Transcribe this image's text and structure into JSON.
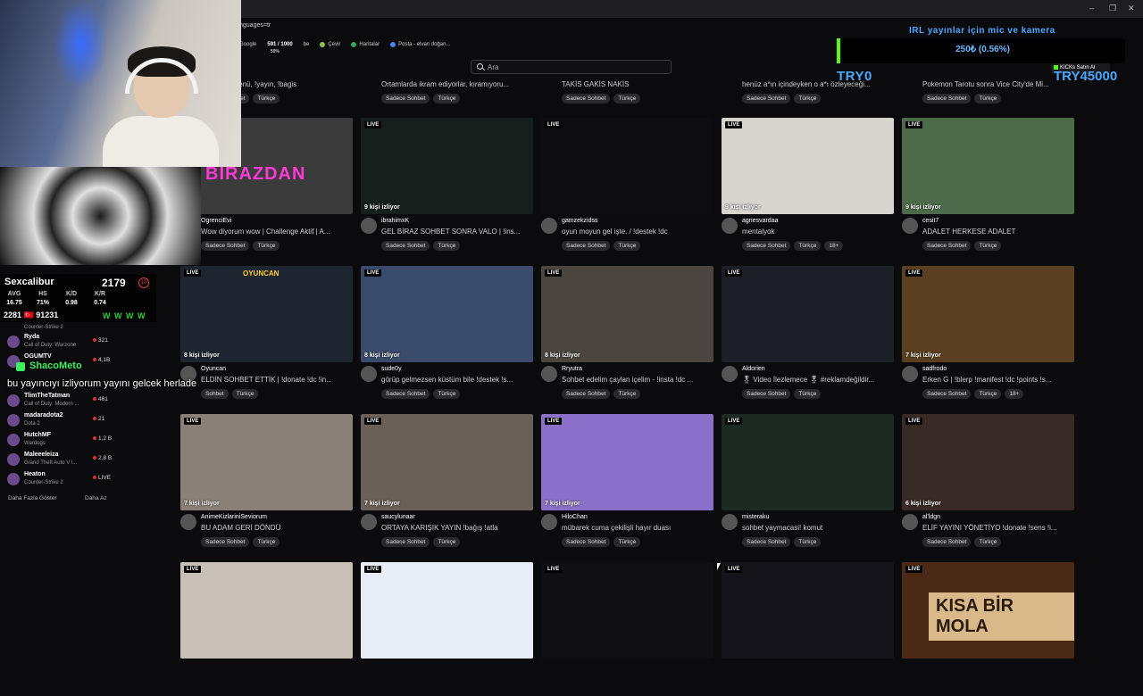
{
  "browser": {
    "url_fragment": "nguages=tr",
    "bookmarks": [
      "Google",
      "591 / 1000",
      "be",
      "Çevir",
      "Haritalar",
      "Posta - elvan doğan..."
    ],
    "bookmark_sub": "59%",
    "window_controls": [
      "–",
      "❐",
      "✕"
    ]
  },
  "search": {
    "placeholder": "Ara"
  },
  "kick_button": {
    "label": "KICKs Satın Al"
  },
  "top_row": [
    {
      "title": "umalaaer menü, !yayın, !bagis",
      "tags": [
        "Sadece Sohbet",
        "Türkçe"
      ]
    },
    {
      "title": "Ortamlarda ikram ediyorlar, kıramıyoru...",
      "tags": [
        "Sadece Sohbet",
        "Türkçe"
      ]
    },
    {
      "title": "TAKİS GAKİS NAKİS",
      "tags": [
        "Sadece Sohbet",
        "Türkçe"
      ]
    },
    {
      "title": "henüz a*ın içindeyken o a*ı özleyeceği...",
      "tags": [
        "Sadece Sohbet",
        "Türkçe"
      ]
    },
    {
      "title": "Pokemon Tarotu sonra Vice City'de Mi...",
      "tags": [
        "Sadece Sohbet",
        "Türkçe"
      ]
    }
  ],
  "streams": [
    {
      "name": "OgrenciEvi",
      "title": "Wow diyorum wow | Challenge Aktif | A...",
      "viewers": "",
      "tags": [
        "Sadece Sohbet",
        "Türkçe"
      ],
      "overlay": "BİRAZDAN",
      "bg": "#3b3b3b"
    },
    {
      "name": "ibrahimxK",
      "title": "GEL BİRAZ SOHBET SONRA VALO | !ins...",
      "viewers": "9 kişi izliyor",
      "tags": [
        "Sadece Sohbet",
        "Türkçe"
      ],
      "overlay": "",
      "bg": "#15201d"
    },
    {
      "name": "gamzekzidss",
      "title": "oyun moyun gel işte. / !destek !dc",
      "viewers": "",
      "tags": [
        "Sadece Sohbet",
        "Türkçe"
      ],
      "overlay": "",
      "bg": "#0d0d10"
    },
    {
      "name": "agnesvardaa",
      "title": "mentalyok",
      "viewers": "9 kişi izliyor",
      "tags": [
        "Sadece Sohbet",
        "Türkçe",
        "18+"
      ],
      "overlay": "",
      "bg": "#d8d4cf"
    },
    {
      "name": "cesit7",
      "title": "ADALET HERKESE ADALET",
      "viewers": "9 kişi izliyor",
      "tags": [
        "Sadece Sohbet",
        "Türkçe"
      ],
      "overlay": "",
      "bg": "#4d6a4a"
    },
    {
      "name": "Oyuncan",
      "title": "ELDİN SOHBET ETTİK | !donate !dc !in...",
      "viewers": "8 kişi izliyor",
      "tags": [
        "Sohbet",
        "Türkçe"
      ],
      "overlay": "OYUNCAN",
      "bg": "#1d2530"
    },
    {
      "name": "sude0y",
      "title": "görüp gelmezsen küstüm bile !destek !s...",
      "viewers": "8 kişi izliyor",
      "tags": [
        "Sadece Sohbet",
        "Türkçe"
      ],
      "overlay": "",
      "bg": "#3a4a6a"
    },
    {
      "name": "Rryutra",
      "title": "Sohbet edelim çaylan içelim - !insta !dc ...",
      "viewers": "8 kişi izliyor",
      "tags": [
        "Sadece Sohbet",
        "Türkçe"
      ],
      "overlay": "",
      "bg": "#4a463f"
    },
    {
      "name": "Aldorien",
      "title": "🎖 Video İlezlemece 🎖 #reklamdeğildir...",
      "viewers": "",
      "tags": [
        "Sadece Sohbet",
        "Türkçe"
      ],
      "overlay": "",
      "bg": "#1c1f26"
    },
    {
      "name": "sadfrodo",
      "title": "Erken G | !blerp !manifest !dc !points !s...",
      "viewers": "7 kişi izliyor",
      "tags": [
        "Sadece Sohbet",
        "Türkçe",
        "18+"
      ],
      "overlay": "",
      "bg": "#5a4020"
    },
    {
      "name": "AnimeKizlariniSeviorum",
      "title": "BU ADAM GERİ DÖNDÜ",
      "viewers": "7 kişi izliyor",
      "tags": [
        "Sadece Sohbet",
        "Türkçe"
      ],
      "overlay": "",
      "bg": "#8a8078"
    },
    {
      "name": "saucylunaar",
      "title": "ORTAYA KARIŞIK YAYIN !bağış !atla",
      "viewers": "7 kişi izliyor",
      "tags": [
        "Sadece Sohbet",
        "Türkçe"
      ],
      "overlay": "",
      "bg": "#6a6058"
    },
    {
      "name": "HiloChan",
      "title": "mübarek cuma çekilişli hayır duası",
      "viewers": "7 kişi izliyor",
      "tags": [
        "Sadece Sohbet",
        "Türkçe"
      ],
      "overlay": "",
      "bg": "#8a70c8"
    },
    {
      "name": "misteraku",
      "title": "sohbet yaymacasi! komut",
      "viewers": "",
      "tags": [
        "Sadece Sohbet",
        "Türkçe"
      ],
      "overlay": "",
      "bg": "#1d2a24"
    },
    {
      "name": "al'ldgn",
      "title": "ELİF YAYINI YÖNETİYO !donate !sens !i...",
      "viewers": "6 kişi izliyor",
      "tags": [
        "Sadece Sohbet",
        "Türkçe"
      ],
      "overlay": "",
      "bg": "#3a2a26"
    },
    {
      "name": "",
      "title": "",
      "viewers": "",
      "tags": [],
      "overlay": "",
      "bg": "#c8c0b6"
    },
    {
      "name": "",
      "title": "",
      "viewers": "",
      "tags": [],
      "overlay": "",
      "bg": "#e8ecf4"
    },
    {
      "name": "",
      "title": "",
      "viewers": "",
      "tags": [],
      "overlay": "",
      "bg": "#101014"
    },
    {
      "name": "",
      "title": "",
      "viewers": "",
      "tags": [],
      "overlay": "",
      "bg": "#14141a"
    },
    {
      "name": "",
      "title": "",
      "viewers": "",
      "tags": [],
      "overlay": "KISA BİR MOLA",
      "bg": "#4a2a16"
    }
  ],
  "live_label": "LIVE",
  "stats": {
    "name": "Sexcalibur",
    "rating": "2179",
    "rank": "10",
    "headers": [
      "AVG",
      "HS",
      "K/D",
      "K/R"
    ],
    "values": [
      "16.75",
      "71%",
      "0.98",
      "0.74"
    ],
    "left_row": "2281 🇹🇷 91231",
    "wins": "W W W W"
  },
  "sidebar": [
    {
      "name": "Ryda",
      "game": "Call of Duty: Warzone",
      "viewers": "321"
    },
    {
      "name": "OGUMTV",
      "game": "",
      "viewers": "4,1B"
    },
    {
      "name": "TlimTheTatman",
      "game": "Call of Duty: Modern ...",
      "viewers": "461"
    },
    {
      "name": "madaradota2",
      "game": "Dota 2",
      "viewers": "21"
    },
    {
      "name": "HutchMF",
      "game": "Wardogs",
      "viewers": "1,2 B"
    },
    {
      "name": "Maleeeleiza",
      "game": "Grand Theft Auto V l...",
      "viewers": "2,8 B"
    },
    {
      "name": "Heaton",
      "game": "Counter-Strike 2",
      "viewers": "LIVE"
    }
  ],
  "sidebar_top_game": "Counter-Strike 2",
  "sidebar_footer": {
    "more": "Daha Fazla Göster",
    "less": "Daha Az"
  },
  "chat": {
    "user": "ShacoMeto",
    "message": "bu yayıncıyı izliyorum yayını gelcek herlade"
  },
  "overlay": {
    "irl_text": "IRL yayınlar için mic ve kamera",
    "goal_text": "250₺ (0.56%)",
    "current": "TRY0",
    "target": "TRY45000",
    "progress_percent": 0.56
  }
}
